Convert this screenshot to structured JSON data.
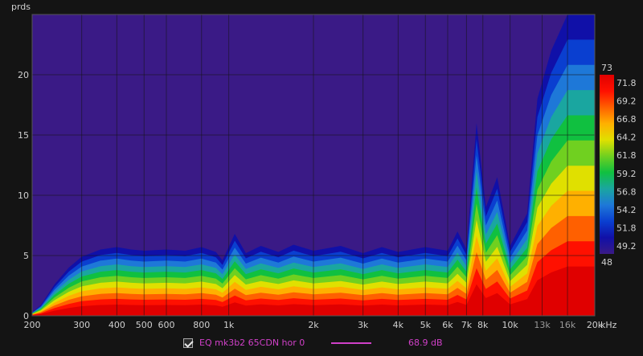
{
  "chart_data": {
    "type": "heatmap",
    "ylabel": "prds",
    "xunit": "kHz",
    "x_scale": "log",
    "xlim": [
      200,
      20000
    ],
    "ylim": [
      0,
      25
    ],
    "x_ticks": [
      {
        "v": 200,
        "t": "200"
      },
      {
        "v": 300,
        "t": "300"
      },
      {
        "v": 400,
        "t": "400"
      },
      {
        "v": 500,
        "t": "500"
      },
      {
        "v": 600,
        "t": "600"
      },
      {
        "v": 800,
        "t": "800"
      },
      {
        "v": 1000,
        "t": "1k"
      },
      {
        "v": 2000,
        "t": "2k"
      },
      {
        "v": 3000,
        "t": "3k"
      },
      {
        "v": 4000,
        "t": "4k"
      },
      {
        "v": 5000,
        "t": "5k"
      },
      {
        "v": 6000,
        "t": "6k"
      },
      {
        "v": 7000,
        "t": "7k"
      },
      {
        "v": 8000,
        "t": "8k"
      },
      {
        "v": 10000,
        "t": "10k"
      },
      {
        "v": 13000,
        "t": "13k"
      },
      {
        "v": 16000,
        "t": "16k"
      },
      {
        "v": 20000,
        "t": "20k"
      }
    ],
    "dim_ticks": [
      "13k",
      "16k"
    ],
    "y_ticks": [
      0,
      5,
      10,
      15,
      20
    ],
    "grid": true,
    "colorbar": {
      "min": 48,
      "max": 73,
      "labels": [
        "73",
        "71.8",
        "69.2",
        "66.8",
        "64.2",
        "61.8",
        "59.2",
        "56.8",
        "54.2",
        "51.8",
        "49.2",
        "48"
      ],
      "colors": [
        "#3a1a86",
        "#1010a8",
        "#0a3fd0",
        "#1e78d8",
        "#1aa6a0",
        "#10c040",
        "#70d020",
        "#e0e000",
        "#ffb000",
        "#ff6000",
        "#ff1000",
        "#e00000"
      ]
    },
    "background_color": "#3a1a86",
    "series": [
      {
        "name": "EQ mk3b2 65CDN hor 0",
        "color": "#d040c8",
        "value_label": "68.9 dB",
        "decay_envelope": [
          {
            "f": 200,
            "p": 0.3
          },
          {
            "f": 215,
            "p": 0.9
          },
          {
            "f": 240,
            "p": 2.6
          },
          {
            "f": 270,
            "p": 4.0
          },
          {
            "f": 300,
            "p": 4.9
          },
          {
            "f": 350,
            "p": 5.5
          },
          {
            "f": 400,
            "p": 5.7
          },
          {
            "f": 450,
            "p": 5.5
          },
          {
            "f": 500,
            "p": 5.4
          },
          {
            "f": 600,
            "p": 5.5
          },
          {
            "f": 700,
            "p": 5.4
          },
          {
            "f": 800,
            "p": 5.7
          },
          {
            "f": 900,
            "p": 5.3
          },
          {
            "f": 950,
            "p": 4.6
          },
          {
            "f": 1050,
            "p": 6.8
          },
          {
            "f": 1150,
            "p": 5.2
          },
          {
            "f": 1300,
            "p": 5.8
          },
          {
            "f": 1500,
            "p": 5.3
          },
          {
            "f": 1700,
            "p": 5.9
          },
          {
            "f": 2000,
            "p": 5.4
          },
          {
            "f": 2500,
            "p": 5.8
          },
          {
            "f": 3000,
            "p": 5.2
          },
          {
            "f": 3500,
            "p": 5.7
          },
          {
            "f": 4000,
            "p": 5.3
          },
          {
            "f": 5000,
            "p": 5.7
          },
          {
            "f": 6000,
            "p": 5.4
          },
          {
            "f": 6500,
            "p": 7.0
          },
          {
            "f": 7000,
            "p": 5.5
          },
          {
            "f": 7600,
            "p": 16.0
          },
          {
            "f": 8200,
            "p": 9.0
          },
          {
            "f": 9000,
            "p": 11.5
          },
          {
            "f": 10000,
            "p": 5.8
          },
          {
            "f": 11500,
            "p": 8.5
          },
          {
            "f": 12500,
            "p": 18.0
          },
          {
            "f": 14000,
            "p": 22.0
          },
          {
            "f": 16000,
            "p": 25.0
          },
          {
            "f": 18000,
            "p": 25.0
          },
          {
            "f": 20000,
            "p": 25.0
          }
        ]
      }
    ]
  }
}
